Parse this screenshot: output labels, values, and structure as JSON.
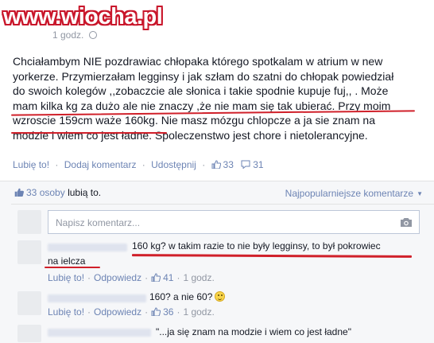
{
  "watermark": "www.wiocha.pl",
  "post": {
    "timestamp": "1 godz.",
    "lines": [
      "Chciałambym NIE pozdrawiac chłopaka którego spotkalam w atrium w new",
      "yorkerze. Przymierzałam legginsy i jak szłam do szatni do chłopak powiedział",
      "do swoich kolegów ,,zobaczcie ale słonica i takie spodnie kupuje fuj,, . Może",
      "mam kilka kg za dużo ale nie znaczy ,że nie mam się tak ubierać. Przy moim",
      "wzroscie 159cm waże 160kg. Nie masz mózgu chlopcze a ja sie znam na",
      "modzie i wiem co jest ładne. Spoleczenstwo jest chore i nietolerancyjne."
    ],
    "actions": {
      "like": "Lubię to!",
      "comment": "Dodaj komentarz",
      "share": "Udostępnij",
      "like_count": "33",
      "comment_count": "31"
    }
  },
  "panel": {
    "likes_count": "33",
    "likes_text": "osoby",
    "likes_link": "lubią to.",
    "sort_label": "Najpopularniejsze komentarze",
    "input_placeholder": "Napisz komentarz..."
  },
  "comments": [
    {
      "line1": "160 kg? w takim razie to nie były legginsy, to był pokrowiec",
      "line2": "na ielcza",
      "like": "Lubię to!",
      "reply": "Odpowiedz",
      "likes": "41",
      "time": "1 godz."
    },
    {
      "line1": "160? a nie 60?",
      "like": "Lubię to!",
      "reply": "Odpowiedz",
      "likes": "36",
      "time": "1 godz."
    },
    {
      "line1": "\"...ja się znam na modzie i wiem co jest ładne\""
    }
  ],
  "icons": {
    "globe": "globe-icon",
    "thumb": "thumbs-up-icon",
    "bubble": "comment-bubble-icon",
    "camera": "camera-icon",
    "smiley": "smiley-icon",
    "caret": "caret-down-icon"
  },
  "colors": {
    "link": "#6d84b4",
    "underline": "#d0202a",
    "watermark": "#c9162b"
  }
}
